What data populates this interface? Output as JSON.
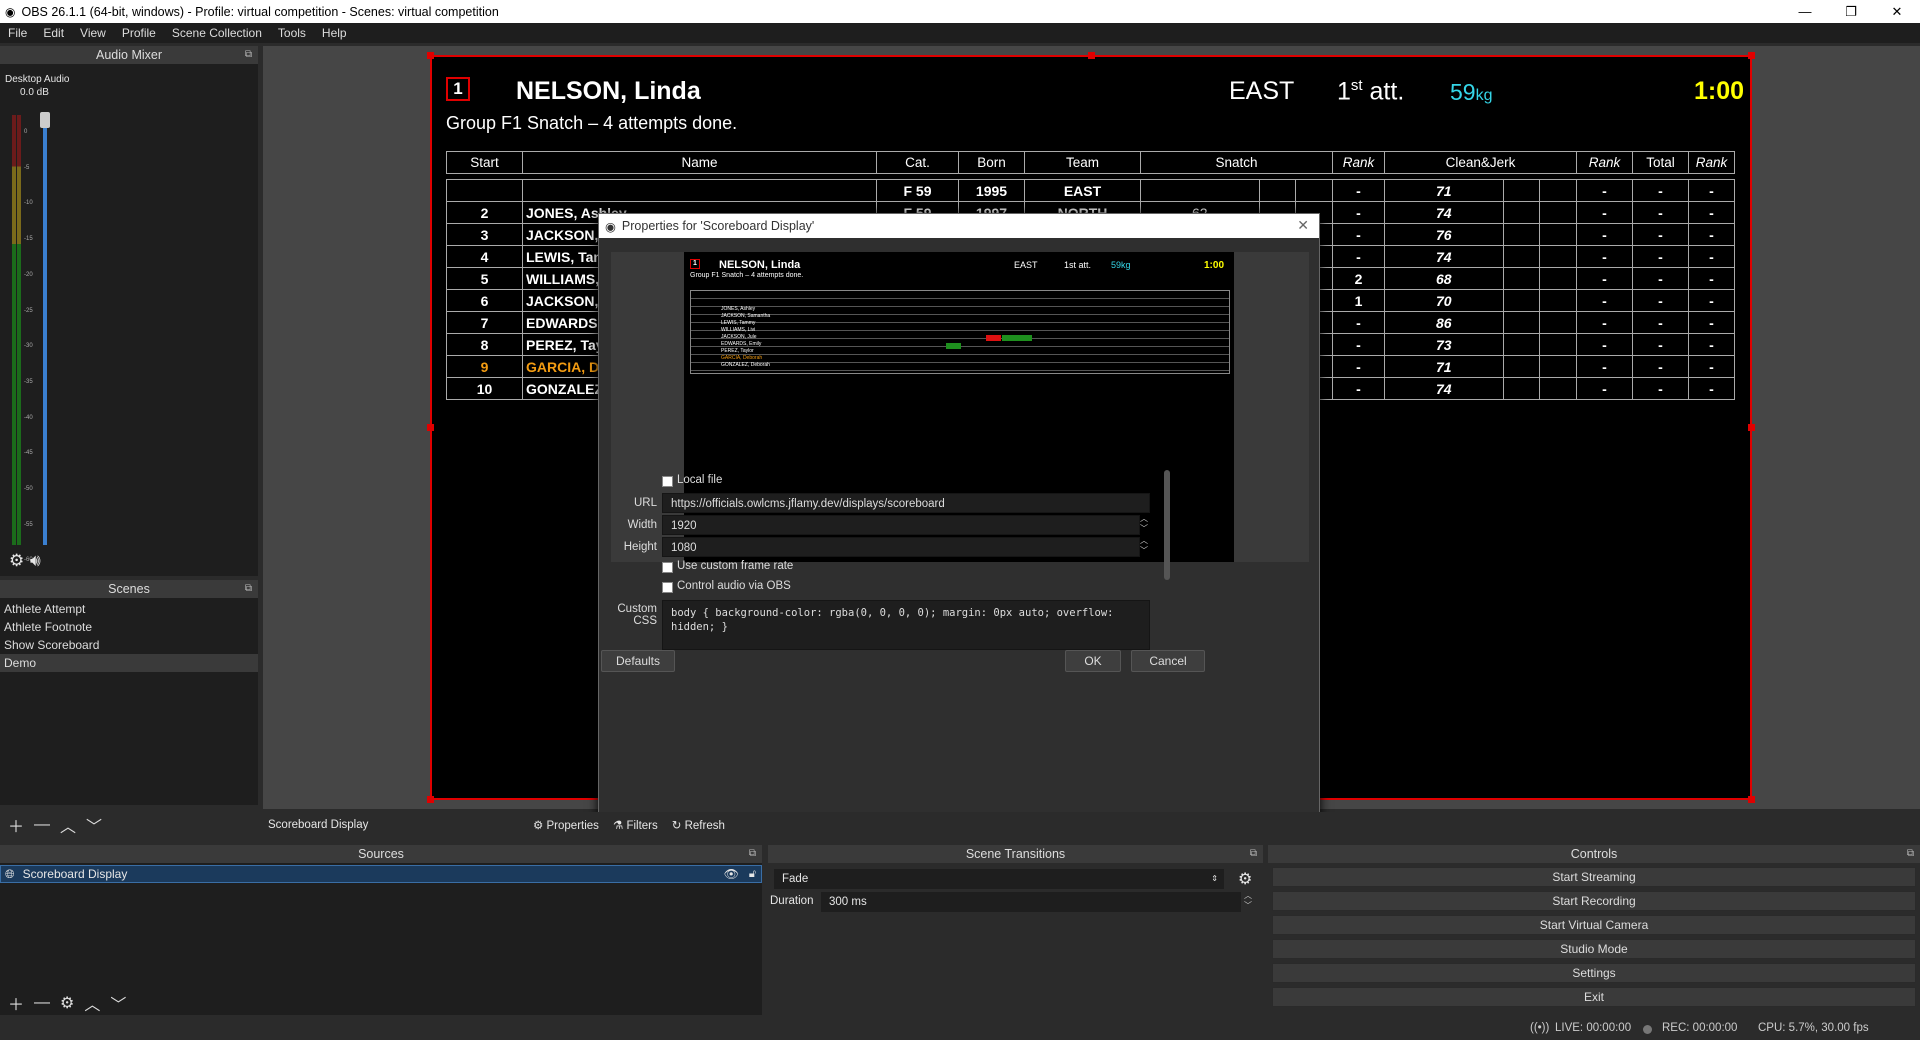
{
  "window": {
    "title": "OBS 26.1.1 (64-bit, windows) - Profile: virtual competition - Scenes: virtual competition",
    "minimize": "—",
    "maximize": "❐",
    "close": "✕"
  },
  "menu": [
    "File",
    "Edit",
    "View",
    "Profile",
    "Scene Collection",
    "Tools",
    "Help"
  ],
  "mixer": {
    "title": "Audio Mixer",
    "source": "Desktop Audio",
    "level": "0.0 dB",
    "ticks": [
      "0",
      "-5",
      "-10",
      "-15",
      "-20",
      "-25",
      "-30",
      "-35",
      "-40",
      "-45",
      "-50",
      "-55",
      "-60"
    ]
  },
  "scenes": {
    "title": "Scenes",
    "items": [
      "Athlete Attempt",
      "Athlete Footnote",
      "Show Scoreboard",
      "Demo"
    ],
    "selected": "Demo"
  },
  "sources": {
    "title": "Sources",
    "items": [
      "Scoreboard Display"
    ]
  },
  "source_toolbar": {
    "selected_source": "Scoreboard Display",
    "properties": "Properties",
    "filters": "Filters",
    "refresh": "Refresh"
  },
  "scoreboard": {
    "start_number": "1",
    "athlete": "NELSON, Linda",
    "team": "EAST",
    "attempt_num": "1",
    "attempt_sup": "st",
    "attempt_suffix": " att.",
    "weight": "59",
    "weight_unit": "kg",
    "clock": "1:00",
    "group_line": "Group F1 Snatch – 4 attempts done.",
    "headers": [
      "Start",
      "Name",
      "Cat.",
      "Born",
      "Team",
      "Snatch",
      "Rank",
      "Clean&Jerk",
      "Rank",
      "Total",
      "Rank"
    ],
    "rows": [
      {
        "start": "",
        "name": "",
        "cat": "F 59",
        "born": "1995",
        "team": "EAST",
        "rank1": "-",
        "cj": "71",
        "rank2": "-",
        "total": "-",
        "rank3": "-"
      },
      {
        "start": "2",
        "name": "JONES, Ashley",
        "cat": "F 59",
        "born": "1997",
        "team": "NORTH",
        "sn": "62",
        "rank1": "-",
        "cj": "74",
        "rank2": "-",
        "total": "-",
        "rank3": "-"
      },
      {
        "start": "3",
        "name": "JACKSON, S",
        "cat": "",
        "born": "",
        "team": "",
        "rank1": "-",
        "cj": "76",
        "rank2": "-",
        "total": "-",
        "rank3": "-"
      },
      {
        "start": "4",
        "name": "LEWIS, Tam",
        "cat": "",
        "born": "",
        "team": "",
        "rank1": "-",
        "cj": "74",
        "rank2": "-",
        "total": "-",
        "rank3": "-"
      },
      {
        "start": "5",
        "name": "WILLIAMS, I",
        "cat": "",
        "born": "",
        "team": "",
        "rank1": "2",
        "cj": "68",
        "rank2": "-",
        "total": "-",
        "rank3": "-"
      },
      {
        "start": "6",
        "name": "JACKSON, J",
        "cat": "",
        "born": "",
        "team": "",
        "rank1": "1",
        "cj": "70",
        "rank2": "-",
        "total": "-",
        "rank3": "-"
      },
      {
        "start": "7",
        "name": "EDWARDS,",
        "cat": "",
        "born": "",
        "team": "",
        "rank1": "-",
        "cj": "86",
        "rank2": "-",
        "total": "-",
        "rank3": "-"
      },
      {
        "start": "8",
        "name": "PEREZ, Tayl",
        "cat": "",
        "born": "",
        "team": "",
        "rank1": "-",
        "cj": "73",
        "rank2": "-",
        "total": "-",
        "rank3": "-"
      },
      {
        "start": "9",
        "name": "GARCIA, De",
        "cat": "",
        "born": "",
        "team": "",
        "rank1": "-",
        "cj": "71",
        "rank2": "-",
        "total": "-",
        "rank3": "-"
      },
      {
        "start": "10",
        "name": "GONZALEZ,",
        "cat": "",
        "born": "",
        "team": "",
        "rank1": "-",
        "cj": "74",
        "rank2": "-",
        "total": "-",
        "rank3": "-"
      }
    ],
    "highlight_color": "#f39c12"
  },
  "dialog": {
    "title": "Properties for 'Scoreboard Display'",
    "thumb": {
      "num": "1",
      "name": "NELSON, Linda",
      "team": "EAST",
      "attempt": "1st att.",
      "weight": "59kg",
      "clock": "1:00",
      "group": "Group F1 Snatch – 4 attempts done.",
      "names": [
        "JONES, Ashley",
        "JACKSON, Samantha",
        "LEWIS, Tammy",
        "WILLIAMS, Livi",
        "JACKSON, Jule",
        "EDWARDS, Emily",
        "PEREZ, Taylor",
        "GARCIA, Deborah",
        "GONZALEZ, Deborah"
      ]
    },
    "local_file": "Local file",
    "url_label": "URL",
    "url": "https://officials.owlcms.jflamy.dev/displays/scoreboard",
    "width_label": "Width",
    "width": "1920",
    "height_label": "Height",
    "height": "1080",
    "custom_fps": "Use custom frame rate",
    "control_audio": "Control audio via OBS",
    "css_label": "Custom CSS",
    "css": "body { background-color: rgba(0, 0, 0, 0); margin: 0px auto; overflow: hidden; }",
    "defaults": "Defaults",
    "ok": "OK",
    "cancel": "Cancel"
  },
  "transitions": {
    "title": "Scene Transitions",
    "type": "Fade",
    "duration_label": "Duration",
    "duration": "300 ms"
  },
  "controls": {
    "title": "Controls",
    "buttons": [
      "Start Streaming",
      "Start Recording",
      "Start Virtual Camera",
      "Studio Mode",
      "Settings",
      "Exit"
    ]
  },
  "status": {
    "live": "LIVE: 00:00:00",
    "rec": "REC: 00:00:00",
    "cpu": "CPU: 5.7%, 30.00 fps"
  },
  "colors": {
    "accent_red": "#e00000",
    "clock_yellow": "#ffff00",
    "weight_cyan": "#35d6e8",
    "good_lift": "#1e8f1e"
  }
}
